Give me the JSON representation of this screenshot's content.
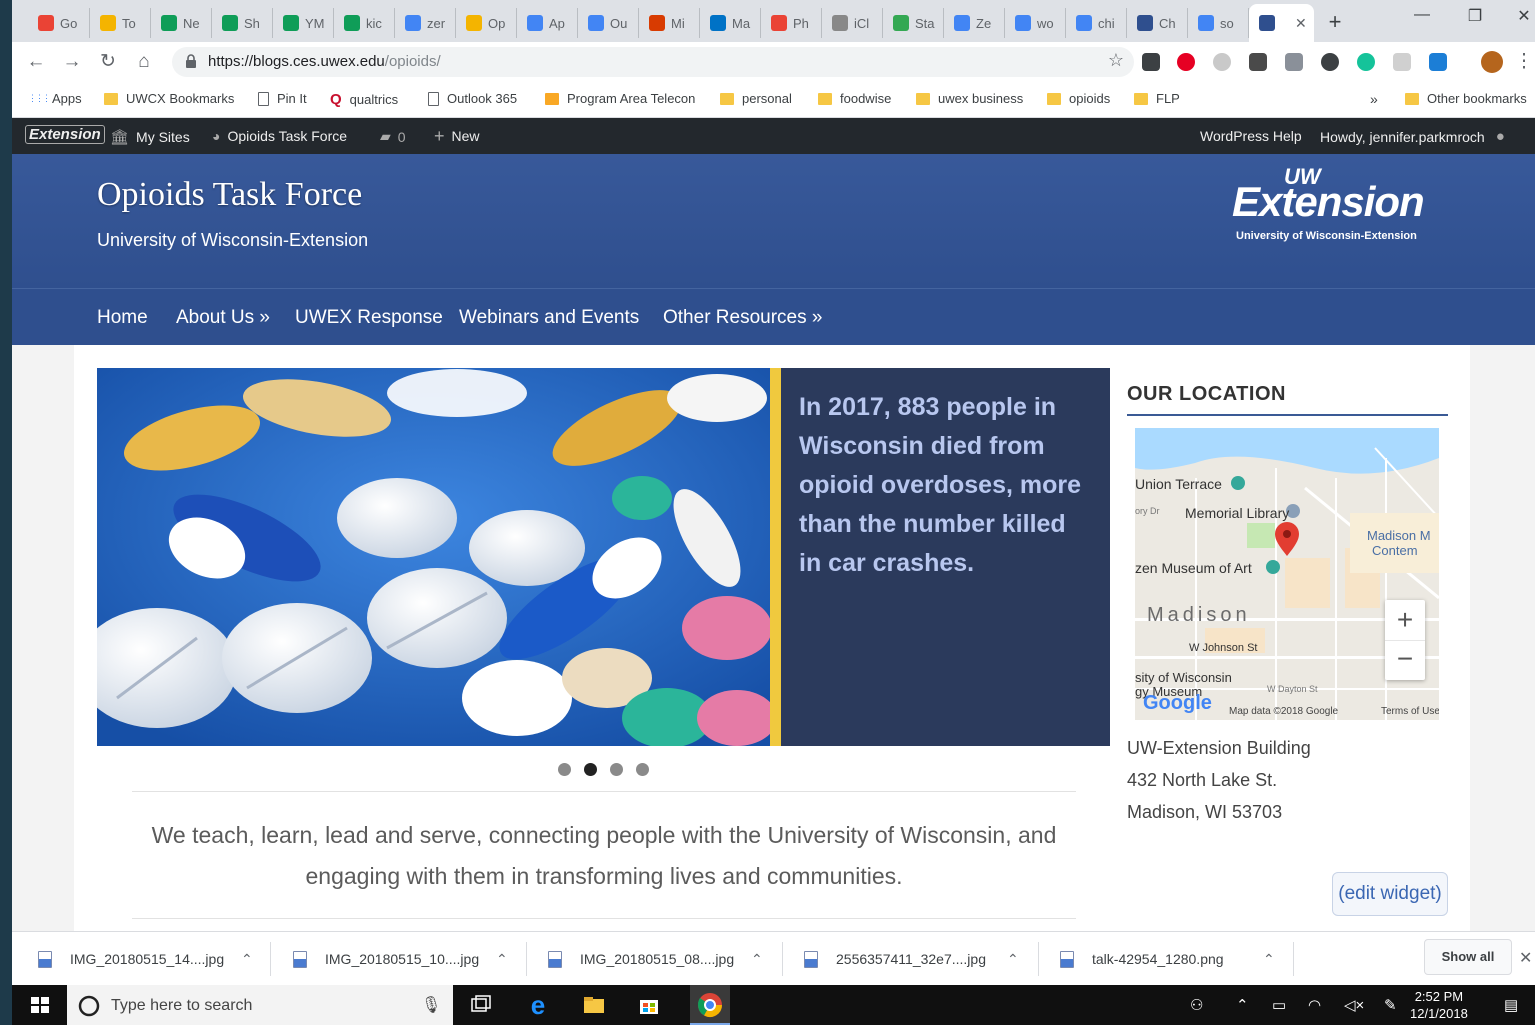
{
  "browser": {
    "tabs": [
      {
        "label": "Go",
        "icon": "google-g-icon",
        "color": "#ea4335"
      },
      {
        "label": "To",
        "icon": "bookmark-icon",
        "color": "#f4b400"
      },
      {
        "label": "Ne",
        "icon": "drive-icon",
        "color": "#0f9d58"
      },
      {
        "label": "Sh",
        "icon": "drive-icon",
        "color": "#0f9d58"
      },
      {
        "label": "YM",
        "icon": "sheets-icon",
        "color": "#0f9d58"
      },
      {
        "label": "kic",
        "icon": "drive-icon",
        "color": "#0f9d58"
      },
      {
        "label": "zer",
        "icon": "docs-icon",
        "color": "#4285f4"
      },
      {
        "label": "Op",
        "icon": "slides-icon",
        "color": "#f4b400"
      },
      {
        "label": "Ap",
        "icon": "docs-icon",
        "color": "#4285f4"
      },
      {
        "label": "Ou",
        "icon": "docs-icon",
        "color": "#4285f4"
      },
      {
        "label": "Mi",
        "icon": "office-icon",
        "color": "#d83b01"
      },
      {
        "label": "Ma",
        "icon": "outlook-icon",
        "color": "#0072c6"
      },
      {
        "label": "Ph",
        "icon": "photos-icon",
        "color": "#ea4335"
      },
      {
        "label": "iCl",
        "icon": "apple-icon",
        "color": "#888888"
      },
      {
        "label": "Sta",
        "icon": "stats-icon",
        "color": "#34a853"
      },
      {
        "label": "Ze",
        "icon": "google-g-icon",
        "color": "#4285f4"
      },
      {
        "label": "wo",
        "icon": "google-g-icon",
        "color": "#4285f4"
      },
      {
        "label": "chi",
        "icon": "google-g-icon",
        "color": "#4285f4"
      },
      {
        "label": "Ch",
        "icon": "extension-icon",
        "color": "#2f4f8e"
      },
      {
        "label": "so",
        "icon": "google-g-icon",
        "color": "#4285f4"
      },
      {
        "label": "",
        "icon": "extension-icon",
        "color": "#2f4f8e",
        "active": true
      }
    ],
    "url_host": "https://blogs.ces.uwex.edu",
    "url_path": "/opioids/",
    "bookmarks": [
      {
        "label": "Apps",
        "type": "apps"
      },
      {
        "label": "UWCX Bookmarks",
        "type": "folder"
      },
      {
        "label": "Pin It",
        "type": "page"
      },
      {
        "label": "qualtrics",
        "type": "qualtrics"
      },
      {
        "label": "Outlook 365",
        "type": "page"
      },
      {
        "label": "Program Area Telecon",
        "type": "calendar"
      },
      {
        "label": "personal",
        "type": "folder"
      },
      {
        "label": "foodwise",
        "type": "folder"
      },
      {
        "label": "uwex business",
        "type": "folder"
      },
      {
        "label": "opioids",
        "type": "folder"
      },
      {
        "label": "FLP",
        "type": "folder"
      }
    ],
    "bookmarks_more": "»",
    "other_bookmarks": "Other bookmarks"
  },
  "wpbar": {
    "logo": "Extension",
    "my_sites": "My Sites",
    "site_name": "Opioids Task Force",
    "comments": "0",
    "new": "New",
    "help": "WordPress Help",
    "howdy": "Howdy, jennifer.parkmroch"
  },
  "site": {
    "title": "Opioids Task Force",
    "subtitle": "University of Wisconsin-Extension",
    "logo_uw": "UW",
    "logo_ext": "Extension",
    "logo_sub": "University of Wisconsin-Extension",
    "nav": [
      "Home",
      "About Us »",
      "UWEX Response",
      "Webinars and Events",
      "Other Resources »"
    ]
  },
  "slider": {
    "text": "In 2017, 883 people in Wisconsin died from opioid overdoses, more than the number killed in car crashes.",
    "dots": 4,
    "active_dot": 1
  },
  "mission": "We teach, learn, lead and serve, connecting people with the University of Wisconsin, and engaging with them in transforming lives and communities.",
  "location": {
    "title": "OUR LOCATION",
    "map_labels": {
      "union": "Union Terrace",
      "memorial": "Memorial Library",
      "museum": "zen Museum of Art",
      "madison": "Madison",
      "madison_m": "Madison M",
      "contem": "Contem",
      "johnson": "W Johnson St",
      "sity": "sity of Wisconsin",
      "gymuseum": "gy Museum",
      "dayton": "W Dayton St",
      "ory": "ory Dr",
      "mapdata": "Map data ©2018 Google",
      "terms": "Terms of Use",
      "google": "Google",
      "zoom_in": "+",
      "zoom_out": "−"
    },
    "address_lines": [
      "UW-Extension Building",
      "432 North Lake St.",
      "Madison, WI 53703"
    ],
    "edit_widget": "(edit widget)"
  },
  "downloads": {
    "files": [
      "IMG_20180515_14....jpg",
      "IMG_20180515_10....jpg",
      "IMG_20180515_08....jpg",
      "2556357411_32e7....jpg",
      "talk-42954_1280.png"
    ],
    "show_all": "Show all"
  },
  "taskbar": {
    "search_placeholder": "Type here to search",
    "time": "2:52 PM",
    "date": "12/1/2018"
  }
}
